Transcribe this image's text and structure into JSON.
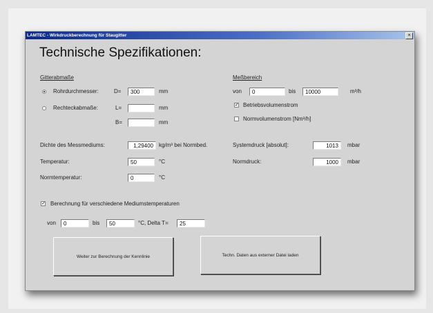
{
  "window": {
    "title": "LAMTEC - Wirkdruckberechnung für Staugitter",
    "close_glyph": "×"
  },
  "heading": "Technische Spezifikationen:",
  "gitter": {
    "section_label": "Gitterabmaße",
    "rohr_label": "Rohrdurchmesser:",
    "rohr_selected": true,
    "d_label": "D=",
    "d_value": "300",
    "d_unit": "mm",
    "rechteck_label": "Rechteckabmaße:",
    "rechteck_selected": false,
    "l_label": "L=",
    "l_value": "",
    "l_unit": "mm",
    "b_label": "B=",
    "b_value": "",
    "b_unit": "mm"
  },
  "messbereich": {
    "section_label": "Meßbereich",
    "von_label": "von",
    "von_value": "0",
    "bis_label": "bis",
    "bis_value": "10000",
    "unit": "m³/h",
    "betrieb_label": "Betriebsvolumenstrom",
    "betrieb_checked": true,
    "norm_label": "Normvolumenstrom [Nm³/h]",
    "norm_checked": false
  },
  "medium": {
    "dichte_label": "Dichte des Messmediums:",
    "dichte_value": "1,29400",
    "dichte_unit": "kg/m³ bei Normbed.",
    "temp_label": "Temperatur:",
    "temp_value": "50",
    "temp_unit": "°C",
    "normtemp_label": "Normtemperatur:",
    "normtemp_value": "0",
    "normtemp_unit": "°C"
  },
  "druck": {
    "system_label": "Systemdruck [absolut]:",
    "system_value": "1013",
    "system_unit": "mbar",
    "norm_label": "Normdruck:",
    "norm_value": "1000",
    "norm_unit": "mbar"
  },
  "temperaturen": {
    "checkbox_label": "Berechnung für verschiedene Mediumstemperaturen",
    "checked": true,
    "von_label": "von",
    "von_value": "0",
    "bis_label": "bis",
    "bis_value": "50",
    "delta_label": "°C, Delta T=",
    "delta_value": "25"
  },
  "buttons": {
    "weiter_label": "Weiter zur Berechnung der Kennlinie",
    "laden_label": "Techn. Daten aus externer Datei laden"
  }
}
